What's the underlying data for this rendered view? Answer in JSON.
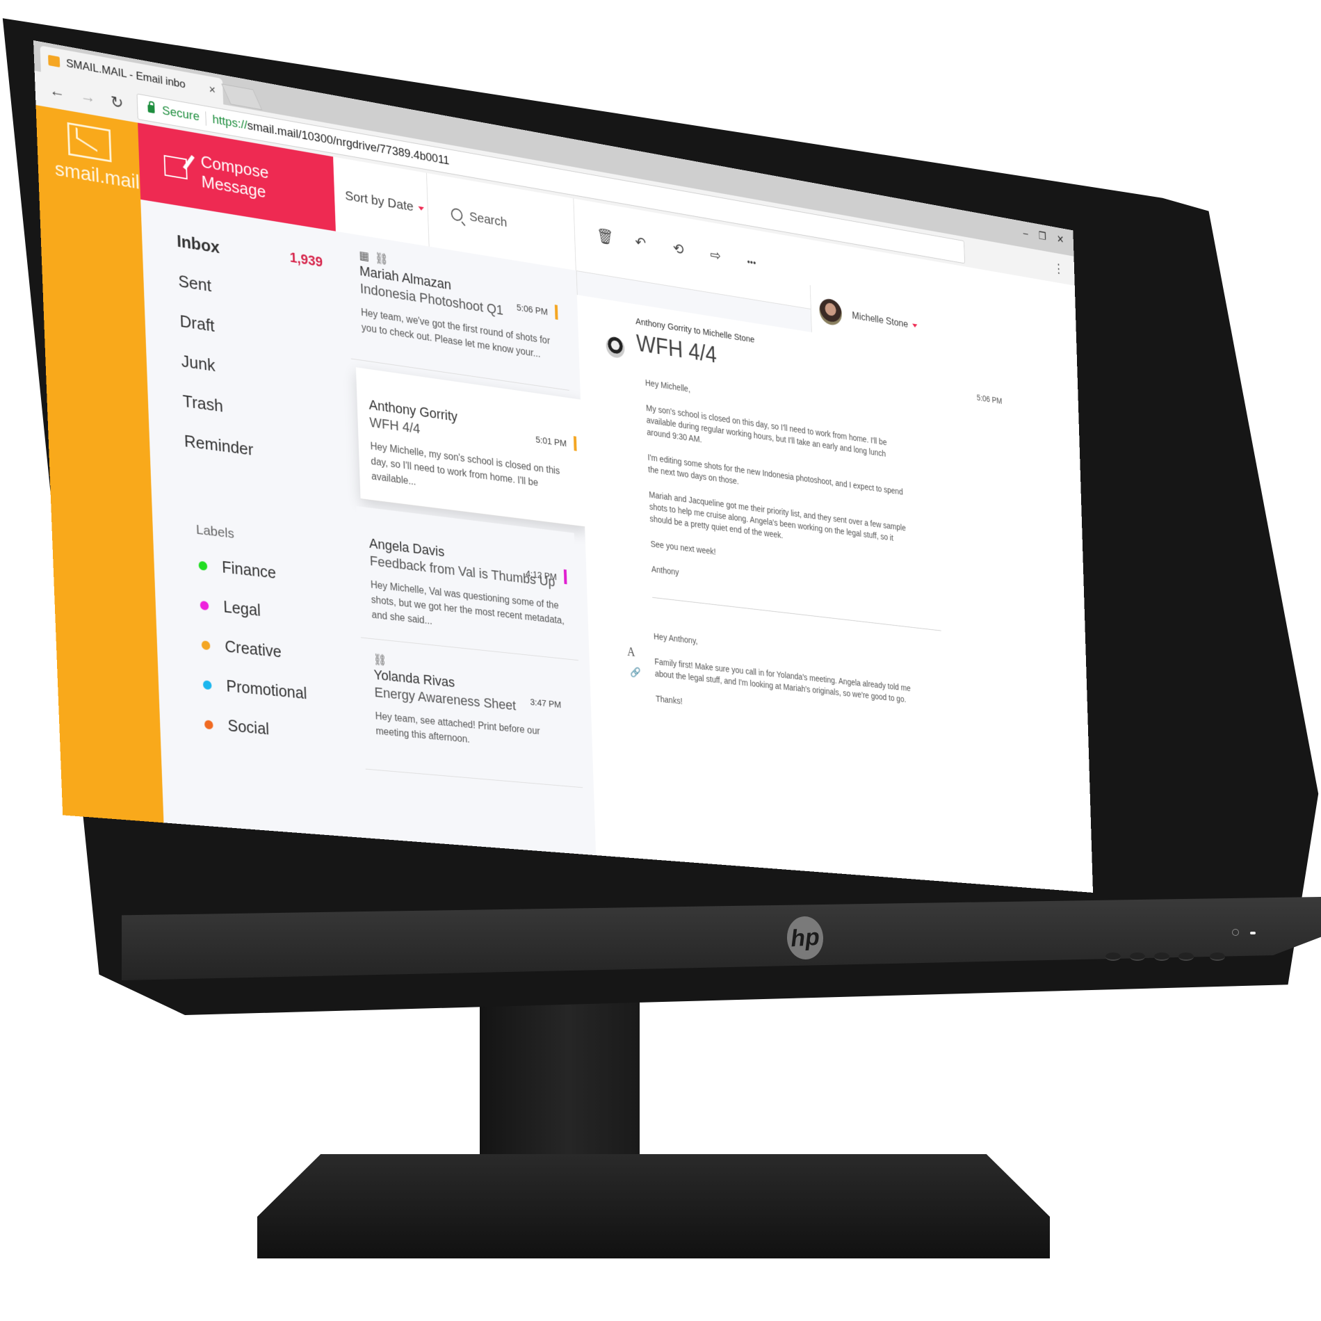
{
  "browser": {
    "tab_title": "SMAIL.MAIL - Email inbo",
    "tab_close": "×",
    "nav_back": "←",
    "nav_forward": "→",
    "nav_reload": "↻",
    "secure_label": "Secure",
    "url_scheme": "https://",
    "url_rest": "smail.mail/10300/nrgdrive/77389.4b0011",
    "window_controls": {
      "minimize": "–",
      "restore": "❐",
      "close": "✕"
    },
    "menu": "⋮"
  },
  "app": {
    "brand_name": "smail.mail",
    "compose_label": "Compose Message",
    "sort_label": "Sort by Date",
    "search_placeholder": "Search",
    "nav": [
      {
        "label": "Inbox",
        "count": "1,939"
      },
      {
        "label": "Sent"
      },
      {
        "label": "Draft"
      },
      {
        "label": "Junk"
      },
      {
        "label": "Trash"
      },
      {
        "label": "Reminder"
      }
    ],
    "labels_header": "Labels",
    "labels": [
      {
        "name": "Finance",
        "color": "#22dd22"
      },
      {
        "name": "Legal",
        "color": "#ee22dd"
      },
      {
        "name": "Creative",
        "color": "#f4a623"
      },
      {
        "name": "Promotional",
        "color": "#1bb6ee"
      },
      {
        "name": "Social",
        "color": "#f06a22"
      }
    ],
    "messages": [
      {
        "from": "Mariah Almazan",
        "subject": "Indonesia Photoshoot Q1",
        "time": "5:06 PM",
        "flag_color": "#f4a623",
        "icons": [
          "calendar-icon",
          "attachment-icon"
        ],
        "preview": "Hey team, we've got the first round of shots for you to check out. Please let me know your..."
      },
      {
        "from": "Anthony Gorrity",
        "subject": "WFH 4/4",
        "time": "5:01 PM",
        "flag_color": "#f4a623",
        "icons": [],
        "preview": "Hey Michelle, my son's school is closed on this day, so I'll need to work from home. I'll be available..."
      },
      {
        "from": "Angela Davis",
        "subject": "Feedback from Val is Thumbs Up",
        "time": "4:12 PM",
        "flag_color": "#e020d0",
        "icons": [],
        "preview": "Hey Michelle, Val was questioning some of the shots, but we got her the most recent metadata, and she said..."
      },
      {
        "from": "Yolanda Rivas",
        "subject": "Energy Awareness Sheet",
        "time": "3:47 PM",
        "flag_color": "",
        "icons": [
          "attachment-icon"
        ],
        "preview": "Hey team, see attached! Print before our meeting this afternoon."
      }
    ],
    "toolbar": {
      "delete": "🗑",
      "reply": "↶",
      "reply_all": "⟲",
      "forward": "⇨",
      "more": "•••"
    },
    "user": {
      "name": "Michelle Stone"
    },
    "reader": {
      "from_to": "Anthony Gorrity to Michelle Stone",
      "subject": "WFH 4/4",
      "time": "5:06 PM",
      "body": [
        "Hey Michelle,",
        "My son's school is closed on this day, so I'll need to work from home. I'll be available during regular working hours, but I'll take an early and long lunch around 9:30 AM.",
        "I'm editing some shots for the new Indonesia photoshoot, and I expect to spend the next two days on those.",
        "Mariah and Jacqueline got me their priority list, and they sent over a few sample shots to help me cruise along. Angela's been working on the legal stuff, so it should be a pretty quiet end of the week.",
        "See you next week!",
        "Anthony"
      ],
      "reply": [
        "Hey Anthony,",
        "Family first! Make sure you call in for Yolanda's meeting. Angela already told me about the legal stuff, and I'm looking at Mariah's originals, so we're good to go.",
        "Thanks!"
      ],
      "format_text_glyph": "A",
      "attach_glyph": "🔗"
    }
  },
  "monitor": {
    "brand": "hp"
  }
}
